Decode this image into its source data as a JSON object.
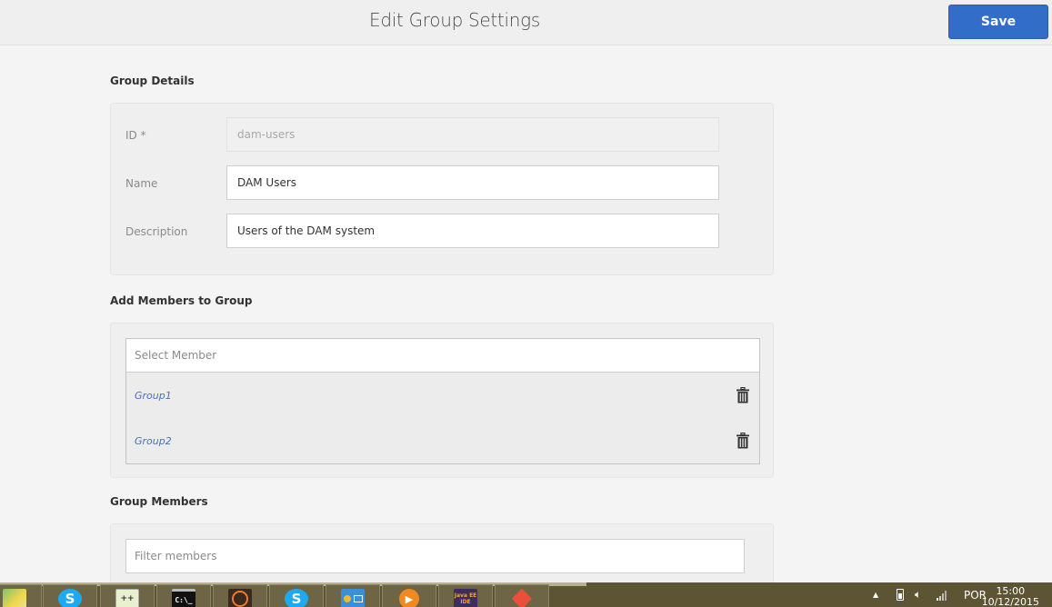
{
  "header": {
    "title": "Edit Group Settings",
    "save_label": "Save",
    "accent_color": "#326ec8"
  },
  "group_details": {
    "section_title": "Group Details",
    "fields": [
      {
        "label": "ID *",
        "value": "dam-users",
        "disabled": true
      },
      {
        "label": "Name",
        "value": "DAM Users",
        "disabled": false
      },
      {
        "label": "Description",
        "value": "Users of the DAM system",
        "disabled": false
      }
    ]
  },
  "add_members": {
    "section_title": "Add Members to Group",
    "select_placeholder": "Select Member",
    "members": [
      {
        "name": "Group1",
        "action_icon": "trash-icon"
      },
      {
        "name": "Group2",
        "action_icon": "trash-icon"
      }
    ]
  },
  "group_members": {
    "section_title": "Group Members",
    "filter_placeholder": "Filter members"
  },
  "taskbar": {
    "apps": [
      {
        "name": "windows-explorer",
        "icon": "folder-icon"
      },
      {
        "name": "skype",
        "icon": "skype-icon",
        "glyph": "S"
      },
      {
        "name": "notepad-plus-plus",
        "icon": "notepad-icon",
        "glyph": "++"
      },
      {
        "name": "command-prompt",
        "icon": "cmd-icon",
        "glyph": "C:\\_"
      },
      {
        "name": "app-orange-circle",
        "icon": "orange-circle-icon"
      },
      {
        "name": "skype-2",
        "icon": "skype-icon",
        "glyph": "S"
      },
      {
        "name": "control-panel",
        "icon": "control-panel-icon"
      },
      {
        "name": "media-player",
        "icon": "play-icon",
        "glyph": "▶"
      },
      {
        "name": "java-ee-ide",
        "icon": "eclipse-icon",
        "glyph": "Java EE IDE"
      },
      {
        "name": "git",
        "icon": "git-icon"
      }
    ],
    "tray": {
      "language": "POR",
      "time": "15:00",
      "date": "10/12/2015"
    }
  }
}
